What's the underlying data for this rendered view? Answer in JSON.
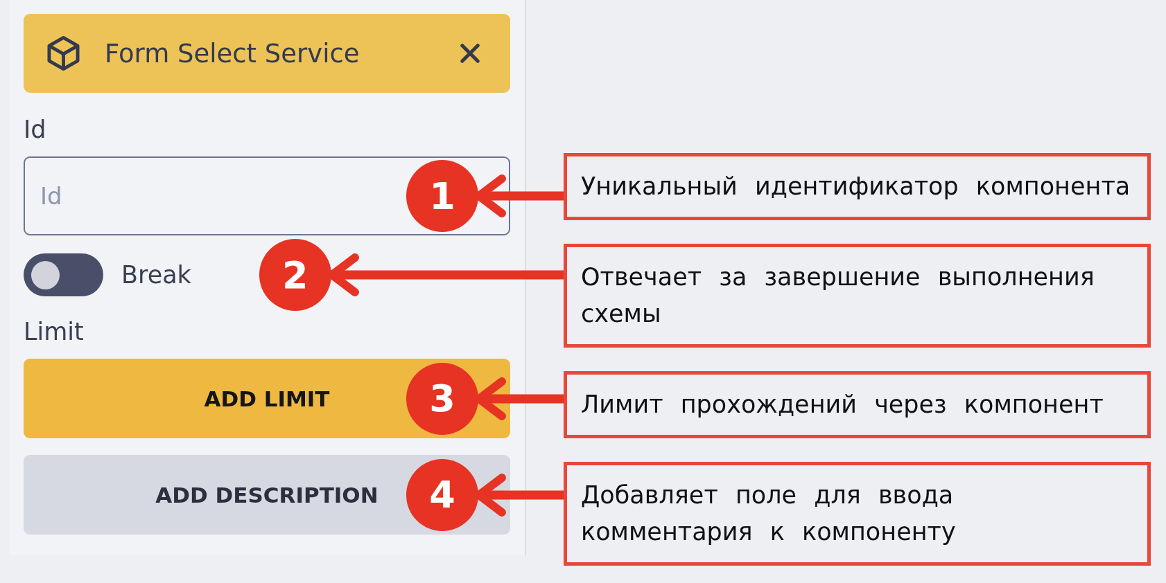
{
  "panel": {
    "header": {
      "title": "Form Select Service"
    },
    "fields": [
      {
        "kind": "text-input",
        "label": "Id",
        "placeholder": "Id",
        "callout": {
          "number": "1",
          "text": "Уникальный идентификатор компонента"
        }
      },
      {
        "kind": "toggle",
        "label": "Break",
        "on": false,
        "callout": {
          "number": "2",
          "text": "Отвечает за завершение выполнения схемы"
        }
      },
      {
        "kind": "primary-button",
        "label": "Limit",
        "button": "ADD LIMIT",
        "callout": {
          "number": "3",
          "text": "Лимит прохождений через компонент"
        }
      },
      {
        "kind": "secondary-button",
        "button": "ADD DESCRIPTION",
        "callout": {
          "number": "4",
          "text": "Добавляет поле для ввода комментария к компоненту"
        }
      }
    ]
  }
}
